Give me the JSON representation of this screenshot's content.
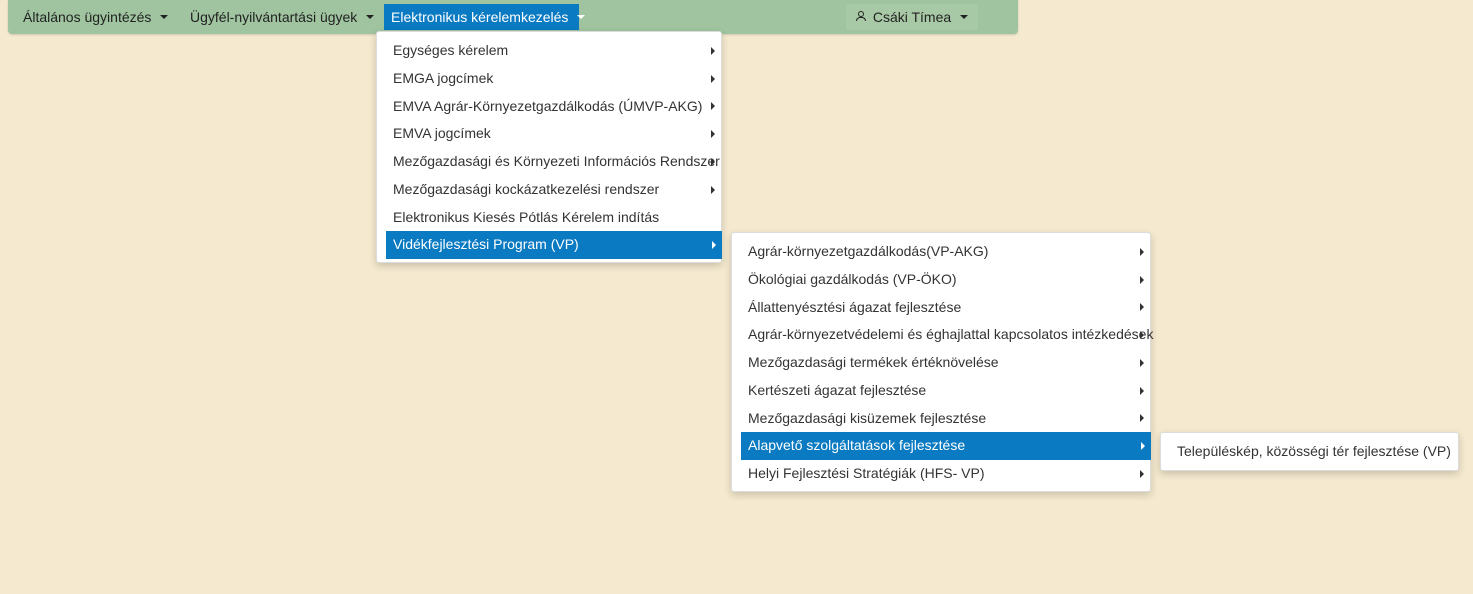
{
  "navbar": {
    "items": [
      {
        "label": "Általános ügyintézés"
      },
      {
        "label": "Ügyfél-nyilvántartási ügyek"
      },
      {
        "label": "Elektronikus kérelemkezelés"
      }
    ],
    "user": {
      "name": "Csáki Tímea",
      "icon": "user-icon"
    }
  },
  "menu1": {
    "items": [
      {
        "label": "Egységes kérelem"
      },
      {
        "label": "EMGA jogcímek"
      },
      {
        "label": "EMVA Agrár-Környezetgazdálkodás (ÚMVP-AKG)"
      },
      {
        "label": "EMVA jogcímek"
      },
      {
        "label": "Mezőgazdasági és Környezeti Információs Rendszer"
      },
      {
        "label": "Mezőgazdasági kockázatkezelési rendszer"
      },
      {
        "label": "Elektronikus Kiesés Pótlás Kérelem indítás"
      },
      {
        "label": "Vidékfejlesztési Program (VP)"
      }
    ]
  },
  "menu2": {
    "items": [
      {
        "label": "Agrár-környezetgazdálkodás(VP-AKG)"
      },
      {
        "label": "Ökológiai gazdálkodás (VP-ÖKO)"
      },
      {
        "label": "Állattenyésztési ágazat fejlesztése"
      },
      {
        "label": "Agrár-környezetvédelemi és éghajlattal kapcsolatos intézkedések"
      },
      {
        "label": "Mezőgazdasági termékek értéknövelése"
      },
      {
        "label": "Kertészeti ágazat fejlesztése"
      },
      {
        "label": "Mezőgazdasági kisüzemek fejlesztése"
      },
      {
        "label": "Alapvető szolgáltatások fejlesztése"
      },
      {
        "label": "Helyi Fejlesztési Stratégiák (HFS- VP)"
      }
    ]
  },
  "menu3": {
    "items": [
      {
        "label": "Településkép, közösségi tér fejlesztése (VP)"
      }
    ]
  },
  "colors": {
    "background": "#f5eacf",
    "navbar": "#9fc49f",
    "accent": "#0a7ac2"
  }
}
